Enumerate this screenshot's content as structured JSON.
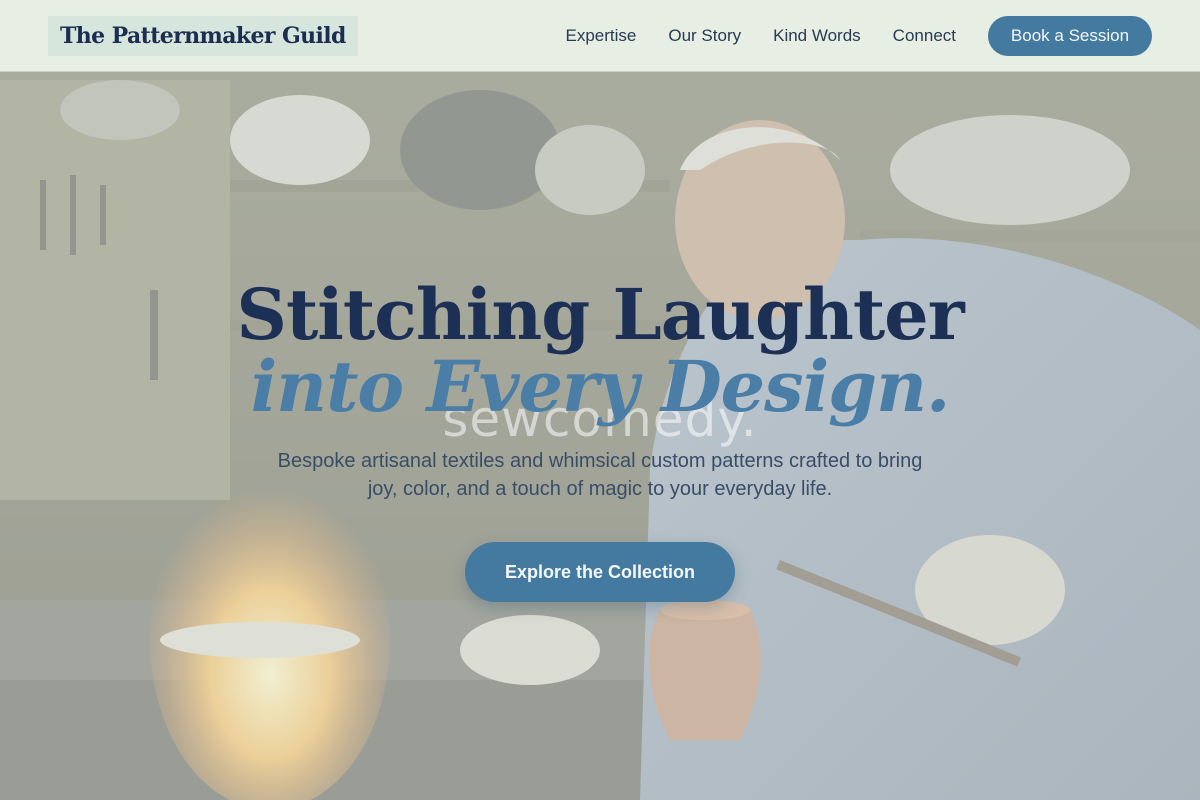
{
  "brand": {
    "name": "The Patternmaker Guild"
  },
  "nav": {
    "links": [
      "Expertise",
      "Our Story",
      "Kind Words",
      "Connect"
    ],
    "cta_label": "Book a Session"
  },
  "hero": {
    "headline_line1": "Stitching Laughter",
    "headline_line2": "into Every Design.",
    "watermark_text": "sewcomedy.",
    "subtitle": "Bespoke artisanal textiles and whimsical custom patterns crafted to bring joy, color, and a touch of magic to your everyday life.",
    "cta_label": "Explore the Collection",
    "background_image": "craftsman-workshop-photo"
  },
  "colors": {
    "brand_navy": "#1c2f55",
    "accent_blue": "#447a9f",
    "headline_italic": "#4a7ea6",
    "nav_bg": "#ecf3ea",
    "logo_bg": "#d6e6dc"
  }
}
